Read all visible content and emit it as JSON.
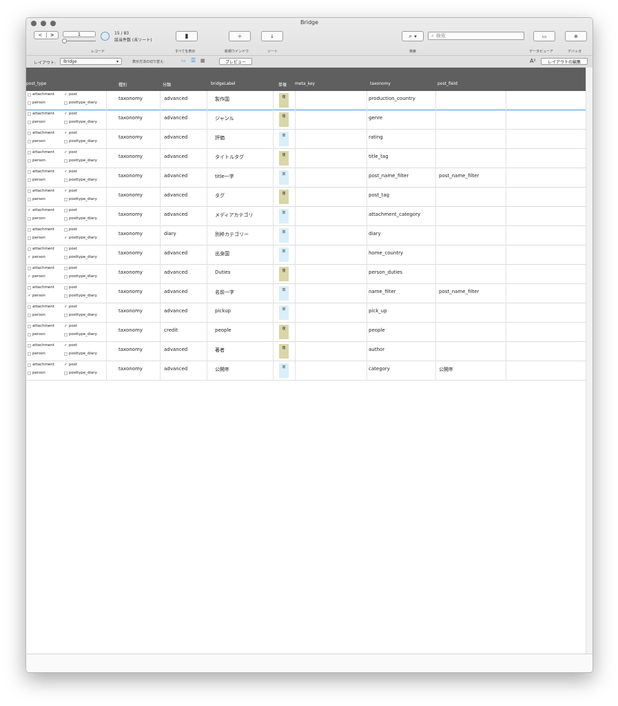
{
  "window": {
    "title": "Bridge"
  },
  "toolbar": {
    "record_value": "1",
    "record_label": "レコード",
    "found_count": "15 / 83",
    "found_label": "該当件数 (未ソート)",
    "show_all_label": "すべてを表示",
    "new_window_label": "新規ウインドウ",
    "sort_label": "ソート",
    "search_label": "検索",
    "search_placeholder": "検索",
    "data_viewer_label": "データビューア",
    "debugger_label": "デバッガ"
  },
  "layoutbar": {
    "layout_label": "レイアウト:",
    "layout_value": "Bridge",
    "view_switch_label": "表示方法の切り替え:",
    "preview_label": "プレビュー",
    "font_icon": "A²",
    "edit_layout_label": "レイアウトの編集"
  },
  "table": {
    "headers": {
      "post_type": "post_type",
      "kind": "種別",
      "category": "分類",
      "label": "bridgeLabel",
      "single_multi": "単複",
      "meta_key": "meta_key",
      "taxonomy": "taxonomy",
      "post_field": "post_field"
    },
    "checkbox_labels": {
      "attachment": "attachment",
      "post": "post",
      "person": "person",
      "diary": "posttype_diary"
    },
    "rows": [
      {
        "attachment": false,
        "post": true,
        "person": false,
        "diary": false,
        "kind": "taxonomy",
        "category": "advanced",
        "label": "製作国",
        "sm": "複",
        "meta_key": "",
        "taxonomy": "production_country",
        "post_field": ""
      },
      {
        "attachment": false,
        "post": true,
        "person": false,
        "diary": false,
        "kind": "taxonomy",
        "category": "advanced",
        "label": "ジャンル",
        "sm": "複",
        "meta_key": "",
        "taxonomy": "genre",
        "post_field": ""
      },
      {
        "attachment": false,
        "post": true,
        "person": false,
        "diary": false,
        "kind": "taxonomy",
        "category": "advanced",
        "label": "評価",
        "sm": "単",
        "meta_key": "",
        "taxonomy": "rating",
        "post_field": ""
      },
      {
        "attachment": false,
        "post": true,
        "person": false,
        "diary": false,
        "kind": "taxonomy",
        "category": "advanced",
        "label": "タイトルタグ",
        "sm": "複",
        "meta_key": "",
        "taxonomy": "title_tag",
        "post_field": ""
      },
      {
        "attachment": false,
        "post": true,
        "person": false,
        "diary": false,
        "kind": "taxonomy",
        "category": "advanced",
        "label": "title一字",
        "sm": "単",
        "meta_key": "",
        "taxonomy": "post_name_filter",
        "post_field": "post_name_filter"
      },
      {
        "attachment": false,
        "post": true,
        "person": false,
        "diary": false,
        "kind": "taxonomy",
        "category": "advanced",
        "label": "タグ",
        "sm": "複",
        "meta_key": "",
        "taxonomy": "post_tag",
        "post_field": ""
      },
      {
        "attachment": true,
        "post": false,
        "person": false,
        "diary": false,
        "kind": "taxonomy",
        "category": "advanced",
        "label": "メディアカテゴリ",
        "sm": "単",
        "meta_key": "",
        "taxonomy": "attachment_category",
        "post_field": ""
      },
      {
        "attachment": false,
        "post": false,
        "person": false,
        "diary": true,
        "kind": "taxonomy",
        "category": "diary",
        "label": "別枠カテゴリー",
        "sm": "単",
        "meta_key": "",
        "taxonomy": "diary",
        "post_field": ""
      },
      {
        "attachment": false,
        "post": false,
        "person": true,
        "diary": false,
        "kind": "taxonomy",
        "category": "advanced",
        "label": "出身国",
        "sm": "単",
        "meta_key": "",
        "taxonomy": "home_country",
        "post_field": ""
      },
      {
        "attachment": false,
        "post": false,
        "person": true,
        "diary": false,
        "kind": "taxonomy",
        "category": "advanced",
        "label": "Duties",
        "sm": "複",
        "meta_key": "",
        "taxonomy": "person_duties",
        "post_field": ""
      },
      {
        "attachment": false,
        "post": false,
        "person": true,
        "diary": false,
        "kind": "taxonomy",
        "category": "advanced",
        "label": "名前一字",
        "sm": "単",
        "meta_key": "",
        "taxonomy": "name_filter",
        "post_field": "post_name_filter"
      },
      {
        "attachment": false,
        "post": true,
        "person": false,
        "diary": false,
        "kind": "taxonomy",
        "category": "advanced",
        "label": "pickup",
        "sm": "単",
        "meta_key": "",
        "taxonomy": "pick_up",
        "post_field": ""
      },
      {
        "attachment": false,
        "post": true,
        "person": false,
        "diary": false,
        "kind": "taxonomy",
        "category": "credit",
        "label": "people",
        "sm": "複",
        "meta_key": "",
        "taxonomy": "people",
        "post_field": ""
      },
      {
        "attachment": false,
        "post": true,
        "person": false,
        "diary": false,
        "kind": "taxonomy",
        "category": "advanced",
        "label": "著者",
        "sm": "複",
        "meta_key": "",
        "taxonomy": "author",
        "post_field": ""
      },
      {
        "attachment": false,
        "post": true,
        "person": false,
        "diary": false,
        "kind": "taxonomy",
        "category": "advanced",
        "label": "公開年",
        "sm": "単",
        "meta_key": "",
        "taxonomy": "category",
        "post_field": "公開年"
      }
    ]
  },
  "colors": {
    "header_bg": "#5f5f5f",
    "multi_badge": "#d9d6a8",
    "single_badge": "#d9effa"
  }
}
